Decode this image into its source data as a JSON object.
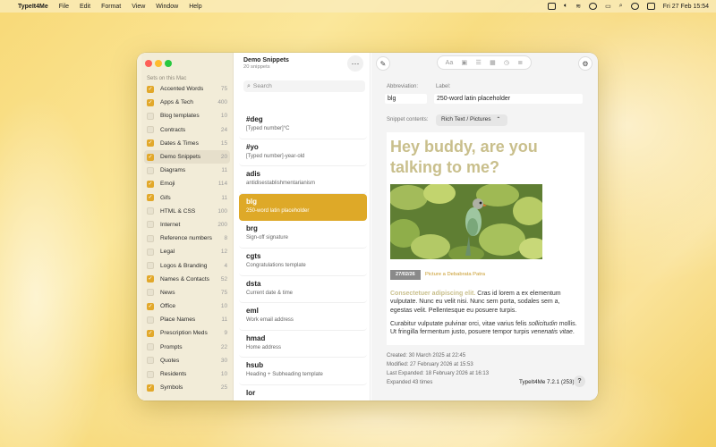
{
  "menubar": {
    "app": "TypeIt4Me",
    "menus": [
      "File",
      "Edit",
      "Format",
      "View",
      "Window",
      "Help"
    ],
    "clock": "Fri 27 Feb  15:54"
  },
  "sidebar": {
    "header": "Sets on this Mac",
    "sets": [
      {
        "name": "Accented Words",
        "count": "75",
        "checked": true
      },
      {
        "name": "Apps & Tech",
        "count": "400",
        "checked": true
      },
      {
        "name": "Blog templates",
        "count": "10",
        "checked": false
      },
      {
        "name": "Contracts",
        "count": "24",
        "checked": false
      },
      {
        "name": "Dates & Times",
        "count": "15",
        "checked": true
      },
      {
        "name": "Demo Snippets",
        "count": "20",
        "checked": true,
        "selected": true
      },
      {
        "name": "Diagrams",
        "count": "11",
        "checked": false
      },
      {
        "name": "Emoji",
        "count": "114",
        "checked": true
      },
      {
        "name": "Gifs",
        "count": "11",
        "checked": true
      },
      {
        "name": "HTML & CSS",
        "count": "100",
        "checked": false
      },
      {
        "name": "Internet",
        "count": "200",
        "checked": false
      },
      {
        "name": "Reference numbers",
        "count": "8",
        "checked": false
      },
      {
        "name": "Legal",
        "count": "12",
        "checked": false
      },
      {
        "name": "Logos & Branding",
        "count": "4",
        "checked": false
      },
      {
        "name": "Names & Contacts",
        "count": "52",
        "checked": true
      },
      {
        "name": "News",
        "count": "75",
        "checked": false
      },
      {
        "name": "Office",
        "count": "10",
        "checked": true
      },
      {
        "name": "Place Names",
        "count": "11",
        "checked": false
      },
      {
        "name": "Prescription Meds",
        "count": "9",
        "checked": true
      },
      {
        "name": "Prompts",
        "count": "22",
        "checked": false
      },
      {
        "name": "Quotes",
        "count": "30",
        "checked": false
      },
      {
        "name": "Residents",
        "count": "10",
        "checked": false
      },
      {
        "name": "Symbols",
        "count": "25",
        "checked": true
      }
    ]
  },
  "snippets": {
    "set_title": "Demo Snippets",
    "set_subtitle": "20 snippets",
    "more_label": "···",
    "search_placeholder": "Search",
    "items": [
      {
        "abbr": "#deg",
        "label": "[Typed number]°C"
      },
      {
        "abbr": "#yo",
        "label": "[Typed number]-year-old"
      },
      {
        "abbr": "adis",
        "label": "antidisestablishmentarianism"
      },
      {
        "abbr": "blg",
        "label": "250-word latin placeholder",
        "selected": true
      },
      {
        "abbr": "brg",
        "label": "Sign-off signature"
      },
      {
        "abbr": "cgts",
        "label": "Congratulations template"
      },
      {
        "abbr": "dsta",
        "label": "Current date & time"
      },
      {
        "abbr": "eml",
        "label": "Work email address"
      },
      {
        "abbr": "hmad",
        "label": "Home address"
      },
      {
        "abbr": "hsub",
        "label": "Heading + Subheading template"
      },
      {
        "abbr": "lor",
        "label": ""
      }
    ]
  },
  "detail": {
    "abbreviation_label": "Abbreviation:",
    "abbreviation_value": "blg",
    "label_label": "Label:",
    "label_value": "250-word latin placeholder",
    "contents_label": "Snippet contents:",
    "contents_type": "Rich Text / Pictures",
    "toolbar_icons": [
      "Aa",
      "image-icon",
      "list-icon",
      "calendar-icon",
      "clock-icon",
      "checklist-icon"
    ],
    "preview": {
      "heading": "Hey buddy, are you talking to me?",
      "date_badge": "27/02/26",
      "caption": "Picture a Debabrata Patra",
      "para1_highlight": "Consectetuer adipiscing elit.",
      "para1_rest": " Cras id lorem a ex elementum vulputate. Nunc eu velit nisi. Nunc sem porta, sodales sem a, egestas velit. Pellentesque eu posuere turpis.",
      "para2_a": "Curabitur vulputate pulvinar orci, vitae varius felis ",
      "para2_italic1": "sollicitudin",
      "para2_b": " mollis. Ut fringilla fermentum justo, posuere tempor turpis ",
      "para2_italic2": "venenatis vitae",
      "para2_c": "."
    },
    "meta": {
      "created": "Created: 30 March 2025 at 22:45",
      "modified": "Modified: 27 February 2026 at 15:53",
      "last_expanded": "Last Expanded: 18 February 2026 at 16:13",
      "expanded": "Expanded 43 times"
    },
    "version": "TypeIt4Me 7.2.1 (253)",
    "help": "?"
  },
  "colors": {
    "accent": "#dea928",
    "heading": "#c9bf8c",
    "checkbox": "#e2a82a"
  }
}
